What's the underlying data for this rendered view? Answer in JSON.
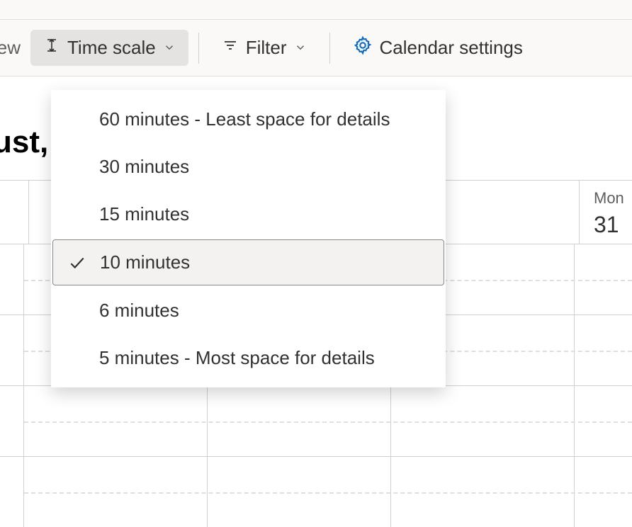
{
  "toolbar": {
    "partial_left_text": "iew",
    "time_scale_label": "Time scale",
    "filter_label": "Filter",
    "settings_label": "Calendar settings"
  },
  "page_title_fragment": "ust,",
  "dropdown": {
    "items": [
      {
        "label": "60 minutes - Least space for details",
        "selected": false
      },
      {
        "label": "30 minutes",
        "selected": false
      },
      {
        "label": "15 minutes",
        "selected": false
      },
      {
        "label": "10 minutes",
        "selected": true
      },
      {
        "label": "6 minutes",
        "selected": false
      },
      {
        "label": "5 minutes - Most space for details",
        "selected": false
      }
    ]
  },
  "calendar": {
    "day_header": {
      "name": "Mon",
      "number": "31"
    }
  }
}
